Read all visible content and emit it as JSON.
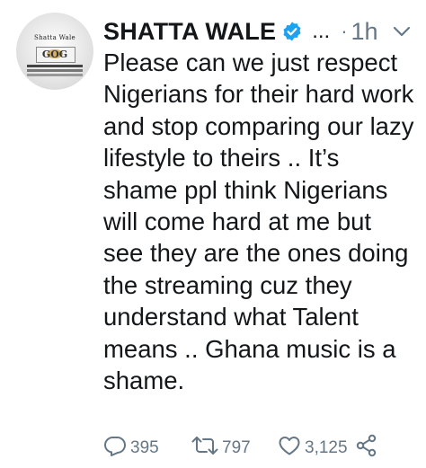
{
  "tweet": {
    "author_name": "SHATTA WALE",
    "more_indicator": "...",
    "separator": "·",
    "timestamp": "1h",
    "text": "Please can we just respect Nigerians for their hard work and stop comparing our lazy lifestyle to theirs .. It’s shame ppl think Nigerians will come hard at me but see they are the ones doing the streaming cuz they understand what Talent means .. Ghana music is a shame.",
    "avatar_text": {
      "top": "Shatta Wale",
      "middle": "GOG"
    }
  },
  "actions": {
    "replies": "395",
    "retweets": "797",
    "likes": "3,125"
  },
  "colors": {
    "verified_blue": "#1da1f2",
    "muted_gray": "#657786",
    "text_dark": "#14171a"
  }
}
